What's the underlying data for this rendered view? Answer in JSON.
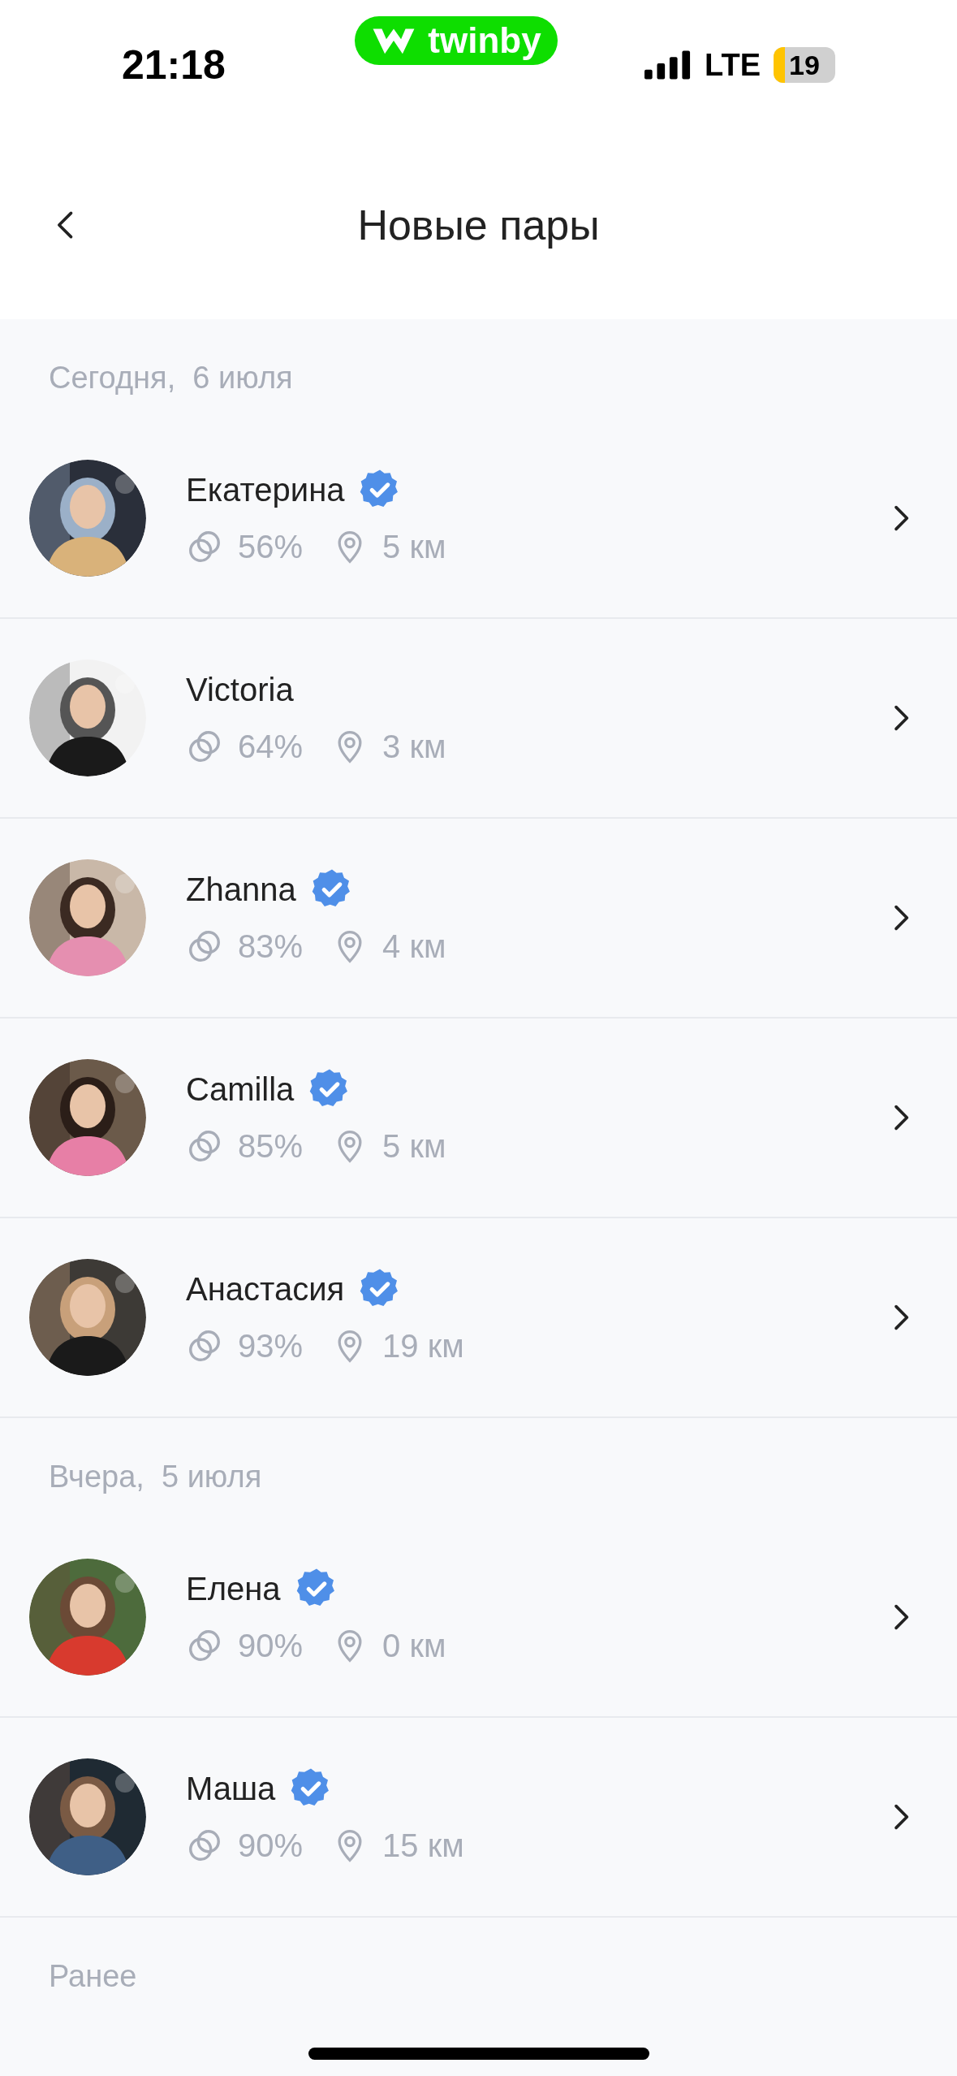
{
  "status_bar": {
    "time": "21:18",
    "app_badge": "twinby",
    "network": "LTE",
    "battery": "19"
  },
  "header": {
    "title": "Новые пары"
  },
  "sections": [
    {
      "title": "Сегодня,  6 июля",
      "matches": [
        {
          "name": "Екатерина",
          "verified": true,
          "compatibility": "56%",
          "distance": "5 км"
        },
        {
          "name": "Victoria",
          "verified": false,
          "compatibility": "64%",
          "distance": "3 км"
        },
        {
          "name": "Zhanna",
          "verified": true,
          "compatibility": "83%",
          "distance": "4 км"
        },
        {
          "name": "Camilla",
          "verified": true,
          "compatibility": "85%",
          "distance": "5 км"
        },
        {
          "name": "Анастасия",
          "verified": true,
          "compatibility": "93%",
          "distance": "19 км"
        }
      ]
    },
    {
      "title": "Вчера,  5 июля",
      "matches": [
        {
          "name": "Елена",
          "verified": true,
          "compatibility": "90%",
          "distance": "0 км"
        },
        {
          "name": "Маша",
          "verified": true,
          "compatibility": "90%",
          "distance": "15 км"
        }
      ]
    },
    {
      "title": "Ранее"
    }
  ]
}
